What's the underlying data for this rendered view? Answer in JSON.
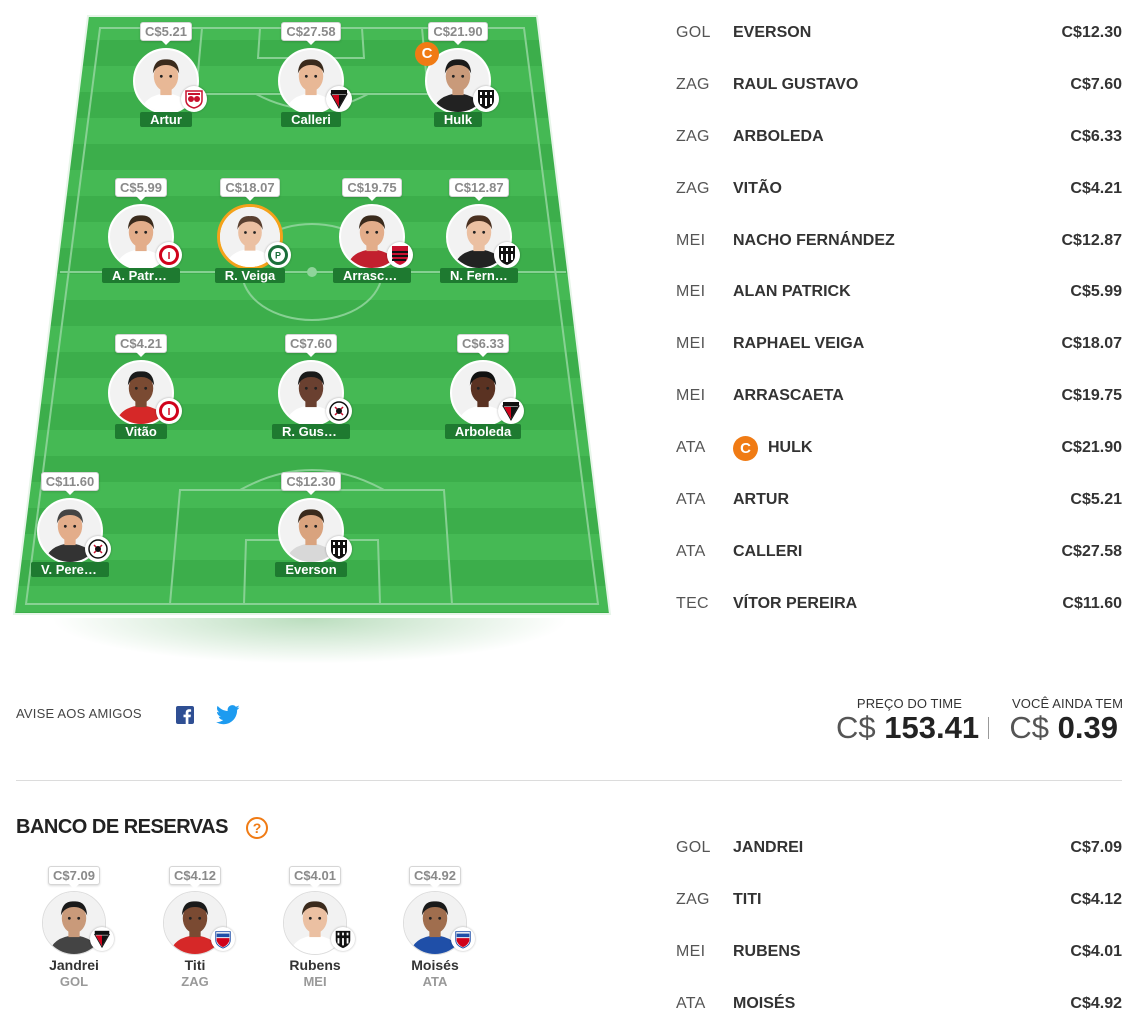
{
  "field": {
    "players": [
      {
        "id": "artur",
        "name": "Artur",
        "price": "C$5.21",
        "club": "bragantino",
        "captain": false,
        "selected": false,
        "skin": "#e8b896",
        "hair": "#3a2a1c",
        "shirt": "#ffffff"
      },
      {
        "id": "calleri",
        "name": "Calleri",
        "price": "C$27.58",
        "club": "sao-paulo",
        "captain": false,
        "selected": false,
        "skin": "#e8b896",
        "hair": "#3a2a1c",
        "shirt": "#ffffff"
      },
      {
        "id": "hulk",
        "name": "Hulk",
        "price": "C$21.90",
        "club": "atletico-mg",
        "captain": true,
        "selected": false,
        "skin": "#c99a7a",
        "hair": "#1a1a1a",
        "shirt": "#222222"
      },
      {
        "id": "a-patrick",
        "name": "A. Patrick",
        "price": "C$5.99",
        "club": "internacional",
        "captain": false,
        "selected": false,
        "skin": "#e3ad8a",
        "hair": "#3a2a1c",
        "shirt": "#ffffff"
      },
      {
        "id": "r-veiga",
        "name": "R. Veiga",
        "price": "C$18.07",
        "club": "palmeiras",
        "captain": false,
        "selected": true,
        "skin": "#ebc0a2",
        "hair": "#5a4030",
        "shirt": "#ffffff"
      },
      {
        "id": "arrascaeta",
        "name": "Arrascae...",
        "price": "C$19.75",
        "club": "flamengo",
        "captain": false,
        "selected": false,
        "skin": "#e3ad8a",
        "hair": "#3a2a1c",
        "shirt": "#c21f2e"
      },
      {
        "id": "n-fernandez",
        "name": "N. Ferná...",
        "price": "C$12.87",
        "club": "atletico-mg",
        "captain": false,
        "selected": false,
        "skin": "#ebc0a2",
        "hair": "#4a3020",
        "shirt": "#222222"
      },
      {
        "id": "vitao",
        "name": "Vitão",
        "price": "C$4.21",
        "club": "internacional",
        "captain": false,
        "selected": false,
        "skin": "#7a4a32",
        "hair": "#1a1a1a",
        "shirt": "#d62828"
      },
      {
        "id": "r-gustavo",
        "name": "R. Gustavo",
        "price": "C$7.60",
        "club": "corinthians",
        "captain": false,
        "selected": false,
        "skin": "#6a4030",
        "hair": "#1a1a1a",
        "shirt": "#ffffff"
      },
      {
        "id": "arboleda",
        "name": "Arboleda",
        "price": "C$6.33",
        "club": "sao-paulo",
        "captain": false,
        "selected": false,
        "skin": "#5a3222",
        "hair": "#111111",
        "shirt": "#ffffff"
      },
      {
        "id": "v-pereira",
        "name": "V. Pereira",
        "price": "C$11.60",
        "club": "corinthians",
        "captain": false,
        "selected": false,
        "skin": "#e3ad8a",
        "hair": "#444444",
        "shirt": "#333333"
      },
      {
        "id": "everson",
        "name": "Everson",
        "price": "C$12.30",
        "club": "atletico-mg",
        "captain": false,
        "selected": false,
        "skin": "#d9a37e",
        "hair": "#3a2a1c",
        "shirt": "#d8d8d8"
      }
    ]
  },
  "captain_letter": "C",
  "starters": [
    {
      "pos": "GOL",
      "name": "EVERSON",
      "price": "C$12.30",
      "captain": false
    },
    {
      "pos": "ZAG",
      "name": "RAUL GUSTAVO",
      "price": "C$7.60",
      "captain": false
    },
    {
      "pos": "ZAG",
      "name": "ARBOLEDA",
      "price": "C$6.33",
      "captain": false
    },
    {
      "pos": "ZAG",
      "name": "VITÃO",
      "price": "C$4.21",
      "captain": false
    },
    {
      "pos": "MEI",
      "name": "NACHO FERNÁNDEZ",
      "price": "C$12.87",
      "captain": false
    },
    {
      "pos": "MEI",
      "name": "ALAN PATRICK",
      "price": "C$5.99",
      "captain": false
    },
    {
      "pos": "MEI",
      "name": "RAPHAEL VEIGA",
      "price": "C$18.07",
      "captain": false
    },
    {
      "pos": "MEI",
      "name": "ARRASCAETA",
      "price": "C$19.75",
      "captain": false
    },
    {
      "pos": "ATA",
      "name": "HULK",
      "price": "C$21.90",
      "captain": true
    },
    {
      "pos": "ATA",
      "name": "ARTUR",
      "price": "C$5.21",
      "captain": false
    },
    {
      "pos": "ATA",
      "name": "CALLERI",
      "price": "C$27.58",
      "captain": false
    },
    {
      "pos": "TEC",
      "name": "VÍTOR PEREIRA",
      "price": "C$11.60",
      "captain": false
    }
  ],
  "share": {
    "label": "AVISE AOS AMIGOS",
    "facebook_icon": "facebook-icon",
    "twitter_icon": "twitter-icon"
  },
  "totals": {
    "team_price_label": "PREÇO DO TIME",
    "team_price_currency": "C$",
    "team_price_value": "153.41",
    "remaining_label": "VOCÊ AINDA TEM",
    "remaining_currency": "C$",
    "remaining_value": "0.39"
  },
  "bench": {
    "title": "BANCO DE RESERVAS",
    "help_symbol": "?",
    "players": [
      {
        "name": "Jandrei",
        "pos": "GOL",
        "price": "C$7.09",
        "club": "sao-paulo",
        "skin": "#c99a7a",
        "hair": "#1a1a1a",
        "shirt": "#444444"
      },
      {
        "name": "Titi",
        "pos": "ZAG",
        "price": "C$4.12",
        "club": "fortaleza",
        "skin": "#7a4a32",
        "hair": "#1a1a1a",
        "shirt": "#d62828"
      },
      {
        "name": "Rubens",
        "pos": "MEI",
        "price": "C$4.01",
        "club": "atletico-mg",
        "skin": "#ebc0a2",
        "hair": "#3a2a1c",
        "shirt": "#ffffff"
      },
      {
        "name": "Moisés",
        "pos": "ATA",
        "price": "C$4.92",
        "club": "fortaleza",
        "skin": "#a06e4e",
        "hair": "#1a1a1a",
        "shirt": "#1f4fa8"
      }
    ],
    "list": [
      {
        "pos": "GOL",
        "name": "JANDREI",
        "price": "C$7.09"
      },
      {
        "pos": "ZAG",
        "name": "TITI",
        "price": "C$4.12"
      },
      {
        "pos": "MEI",
        "name": "RUBENS",
        "price": "C$4.01"
      },
      {
        "pos": "ATA",
        "name": "MOISÉS",
        "price": "C$4.92"
      }
    ]
  },
  "colors": {
    "accent_orange": "#f07b14",
    "field_green": "#3fb34f",
    "name_band": "#1e7a30"
  }
}
